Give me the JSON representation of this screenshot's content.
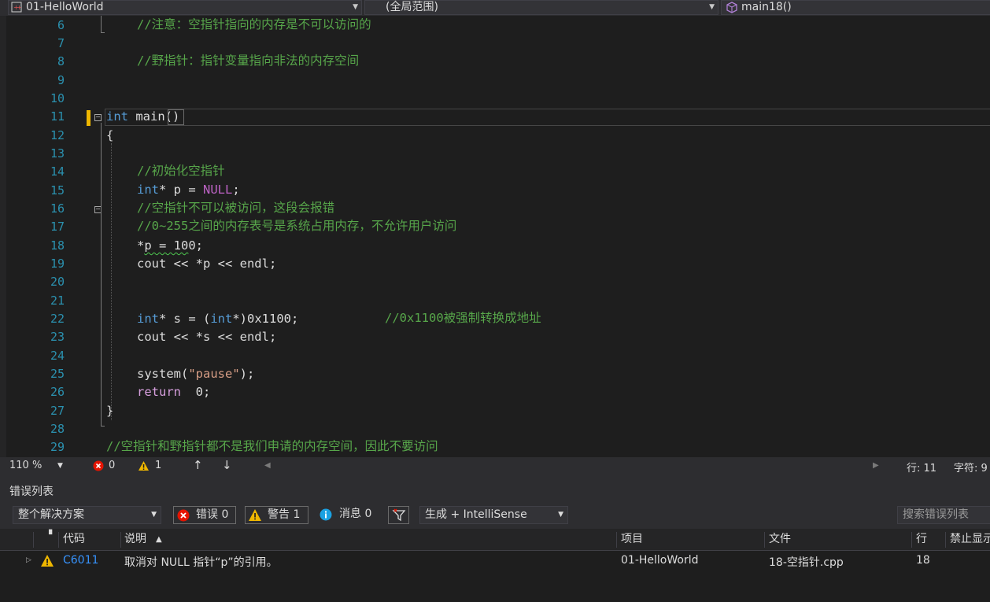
{
  "nav": {
    "project": "01-HelloWorld",
    "scope": "(全局范围)",
    "member": "main18()"
  },
  "editor": {
    "lines": [
      {
        "no": "6"
      },
      {
        "no": "7"
      },
      {
        "no": "8"
      },
      {
        "no": "9"
      },
      {
        "no": "10"
      },
      {
        "no": "11"
      },
      {
        "no": "12"
      },
      {
        "no": "13"
      },
      {
        "no": "14"
      },
      {
        "no": "15"
      },
      {
        "no": "16"
      },
      {
        "no": "17"
      },
      {
        "no": "18"
      },
      {
        "no": "19"
      },
      {
        "no": "20"
      },
      {
        "no": "21"
      },
      {
        "no": "22"
      },
      {
        "no": "23"
      },
      {
        "no": "24"
      },
      {
        "no": "25"
      },
      {
        "no": "26"
      },
      {
        "no": "27"
      },
      {
        "no": "28"
      },
      {
        "no": "29"
      }
    ],
    "code": {
      "l6": "//注意：空指针指向的内存是不可以访问的",
      "l8": "//野指针：指针变量指向非法的内存空间",
      "l11_kw": "int",
      "l11_rest": " main()",
      "l12": "{",
      "l14": "//初始化空指针",
      "l15_kw": "int",
      "l15_a": "* p = ",
      "l15_mac": "NULL",
      "l15_b": ";",
      "l16": "//空指针不可以被访问，这段会报错",
      "l17": "//0~255之间的内存表号是系统占用内存，不允许用户访问",
      "l18_a": "*",
      "l18_sq": "p = 10",
      "l18_b": "0;",
      "l19": "cout << *p << endl;",
      "l22_kw": "int",
      "l22_a": "* s = (",
      "l22_kw2": "int",
      "l22_b": "*)0x1100;",
      "l22_cm": "//0x1100被强制转换成地址",
      "l23": "cout << *s << endl;",
      "l25_a": "system(",
      "l25_str": "\"pause\"",
      "l25_b": ");",
      "l26_kw": "return",
      "l26_b": "  0;",
      "l27": "}",
      "l29": "//空指针和野指针都不是我们申请的内存空间，因此不要访问"
    }
  },
  "status": {
    "zoom": "110 %",
    "errors": "0",
    "warnings": "1",
    "line": "行: 11",
    "char": "字符: 9"
  },
  "errorlist": {
    "title": "错误列表",
    "scope": "整个解决方案",
    "errors_btn": "错误 0",
    "warnings_btn": "警告 1",
    "messages_btn": "消息 0",
    "build_filter": "生成 + IntelliSense",
    "search_placeholder": "搜索错误列表",
    "columns": {
      "code": "代码",
      "desc": "说明",
      "project": "项目",
      "file": "文件",
      "line": "行",
      "suppress": "禁止显示"
    },
    "rows": [
      {
        "code": "C6011",
        "desc": "取消对 NULL 指针“p”的引用。",
        "project": "01-HelloWorld",
        "file": "18-空指针.cpp",
        "line": "18"
      }
    ]
  },
  "colors": {
    "keyword": "#569cd6",
    "comment": "#57a64a",
    "string": "#d69d85",
    "linenum": "#2b91af",
    "warning": "#efb700",
    "error": "#e51400"
  }
}
